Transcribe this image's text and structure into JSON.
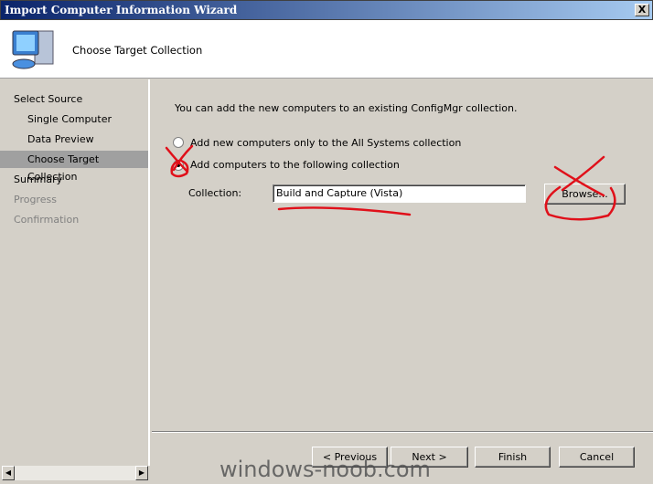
{
  "window": {
    "title": "Import Computer Information Wizard",
    "close": "X"
  },
  "header": {
    "title": "Choose Target Collection",
    "icon": "computer-icon"
  },
  "nav": [
    {
      "label": "Select Source",
      "state": "normal"
    },
    {
      "label": "Single Computer",
      "state": "normal"
    },
    {
      "label": "Data Preview",
      "state": "normal"
    },
    {
      "label": "Choose Target Collection",
      "state": "selected"
    },
    {
      "label": "Summary",
      "state": "normal"
    },
    {
      "label": "Progress",
      "state": "disabled"
    },
    {
      "label": "Confirmation",
      "state": "disabled"
    }
  ],
  "content": {
    "intro": "You can add the new computers to an existing ConfigMgr collection.",
    "option1": "Add new computers only to the All Systems collection",
    "option2": "Add computers to the following collection",
    "selected_option": 2,
    "collection_label": "Collection:",
    "collection_value": "Build and Capture (Vista)",
    "browse": "Browse..."
  },
  "buttons": {
    "previous": "< Previous",
    "next": "Next >",
    "finish": "Finish",
    "cancel": "Cancel"
  },
  "watermark": "windows-noob.com",
  "colors": {
    "annotation": "#e0101a",
    "titlebar": "#0a246a",
    "selected_nav": "#a0a0a0"
  }
}
